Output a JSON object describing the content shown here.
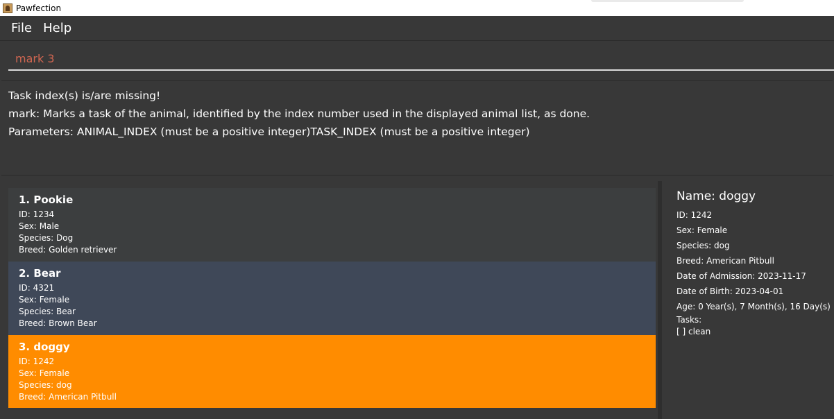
{
  "window": {
    "title": "Pawfection"
  },
  "menu": {
    "file": "File",
    "help": "Help"
  },
  "command": {
    "value": "mark 3"
  },
  "result": {
    "lines": [
      "Task index(s) is/are missing!",
      "mark: Marks a task of the animal, identified by the index number used in the displayed animal list, as done.",
      "Parameters: ANIMAL_INDEX (must be a positive integer)TASK_INDEX (must be a positive integer)"
    ]
  },
  "animals": [
    {
      "title": "1.  Pookie",
      "id": "ID: 1234",
      "sex": "Sex: Male",
      "species": "Species: Dog",
      "breed": "Breed: Golden retriever"
    },
    {
      "title": "2.  Bear",
      "id": "ID: 4321",
      "sex": "Sex: Female",
      "species": "Species: Bear",
      "breed": "Breed: Brown Bear"
    },
    {
      "title": "3.  doggy",
      "id": "ID: 1242",
      "sex": "Sex: Female",
      "species": "Species: dog",
      "breed": "Breed: American Pitbull"
    }
  ],
  "detail": {
    "name": "Name: doggy",
    "id": "ID: 1242",
    "sex": "Sex: Female",
    "species": "Species: dog",
    "breed": "Breed: American Pitbull",
    "admission": "Date of Admission: 2023-11-17",
    "birth": "Date of Birth: 2023-04-01",
    "age": "Age: 0 Year(s), 7 Month(s), 16 Day(s)",
    "tasks_label": "Tasks:",
    "tasks": [
      "[ ] clean"
    ]
  },
  "colors": {
    "background": "#383838",
    "selected_card": "#ff8c00",
    "hover_card": "#3f4858",
    "command_text": "#d06651"
  },
  "icons": {
    "app": "pawfection-app-icon"
  }
}
